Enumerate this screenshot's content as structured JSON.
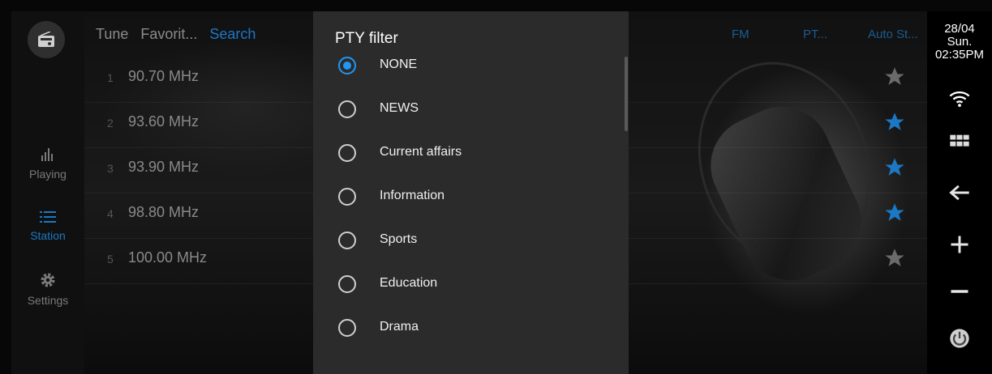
{
  "left_nav": {
    "radio_icon": "radio-icon",
    "items": [
      {
        "label": "Playing",
        "icon": "equalizer-icon"
      },
      {
        "label": "Station",
        "icon": "list-icon"
      },
      {
        "label": "Settings",
        "icon": "gear-icon"
      }
    ]
  },
  "tabs": [
    "Tune",
    "Favorit...",
    "Search"
  ],
  "right_tabs": [
    "FM",
    "PT...",
    "Auto St..."
  ],
  "stations": [
    {
      "num": "1",
      "freq": "90.70 MHz",
      "favorite": false
    },
    {
      "num": "2",
      "freq": "93.60 MHz",
      "favorite": true
    },
    {
      "num": "3",
      "freq": "93.90 MHz",
      "favorite": true
    },
    {
      "num": "4",
      "freq": "98.80 MHz",
      "favorite": true
    },
    {
      "num": "5",
      "freq": "100.00 MHz",
      "favorite": false
    }
  ],
  "status": {
    "date": "28/04",
    "day": "Sun.",
    "time": "02:35PM"
  },
  "dialog": {
    "title": "PTY filter",
    "options": [
      "NONE",
      "NEWS",
      "Current affairs",
      "Information",
      "Sports",
      "Education",
      "Drama"
    ],
    "selected": 0
  },
  "colors": {
    "accent": "#2196f3",
    "favorite": "#1b78c4",
    "star_off": "#6a6a6a"
  }
}
